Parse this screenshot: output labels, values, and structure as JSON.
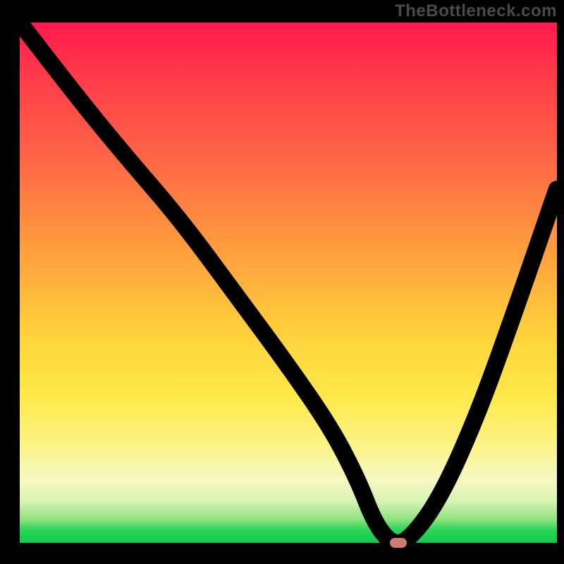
{
  "watermark": "TheBottleneck.com",
  "colors": {
    "marker": "#d07a72",
    "curve": "#000000"
  },
  "chart_data": {
    "type": "line",
    "title": "",
    "xlabel": "",
    "ylabel": "",
    "xlim": [
      0,
      100
    ],
    "ylim": [
      0,
      100
    ],
    "grid": false,
    "legend": false,
    "background_gradient_stops": [
      {
        "pos": 0,
        "color": "#ff1a4d"
      },
      {
        "pos": 0.25,
        "color": "#ff6347"
      },
      {
        "pos": 0.6,
        "color": "#ffd23c"
      },
      {
        "pos": 0.88,
        "color": "#f6f7c2"
      },
      {
        "pos": 1.0,
        "color": "#12c94a"
      }
    ],
    "series": [
      {
        "name": "bottleneck-curve",
        "x": [
          0,
          12,
          20,
          30,
          40,
          50,
          58,
          63,
          66,
          69,
          72,
          78,
          85,
          92,
          100
        ],
        "y": [
          100,
          84,
          74,
          62,
          48,
          34,
          22,
          12,
          4,
          0,
          0,
          8,
          24,
          44,
          68
        ]
      }
    ],
    "marker": {
      "x": 70.5,
      "y": 0
    }
  }
}
